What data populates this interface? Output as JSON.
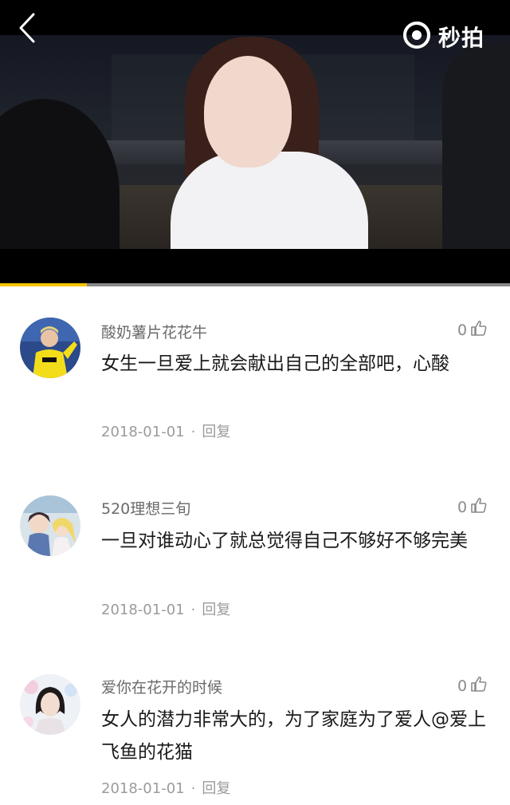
{
  "header": {
    "back_icon": "chevron-left-icon",
    "brand_icon": "miaopai-logo-icon",
    "brand_name": "秒拍"
  },
  "video": {
    "progress": 0.17,
    "progress_color": "#f4c400"
  },
  "comments": [
    {
      "username": "酸奶薯片花花牛",
      "text": "女生一旦爱上就会献出自己的全部吧，心酸",
      "date": "2018-01-01",
      "separator": "·",
      "reply_label": "回复",
      "likes": "0"
    },
    {
      "username": "520理想三旬",
      "text": "一旦对谁动心了就总觉得自己不够好不够完美",
      "date": "2018-01-01",
      "separator": "·",
      "reply_label": "回复",
      "likes": "0"
    },
    {
      "username": "爱你在花开的时候",
      "text": "女人的潜力非常大的，为了家庭为了爱人@爱上飞鱼的花猫",
      "date": "2018-01-01",
      "separator": "·",
      "reply_label": "回复",
      "likes": "0"
    }
  ],
  "colors": {
    "accent": "#f4c400",
    "username": "#6a6a6a",
    "meta": "#9b9b9b"
  }
}
